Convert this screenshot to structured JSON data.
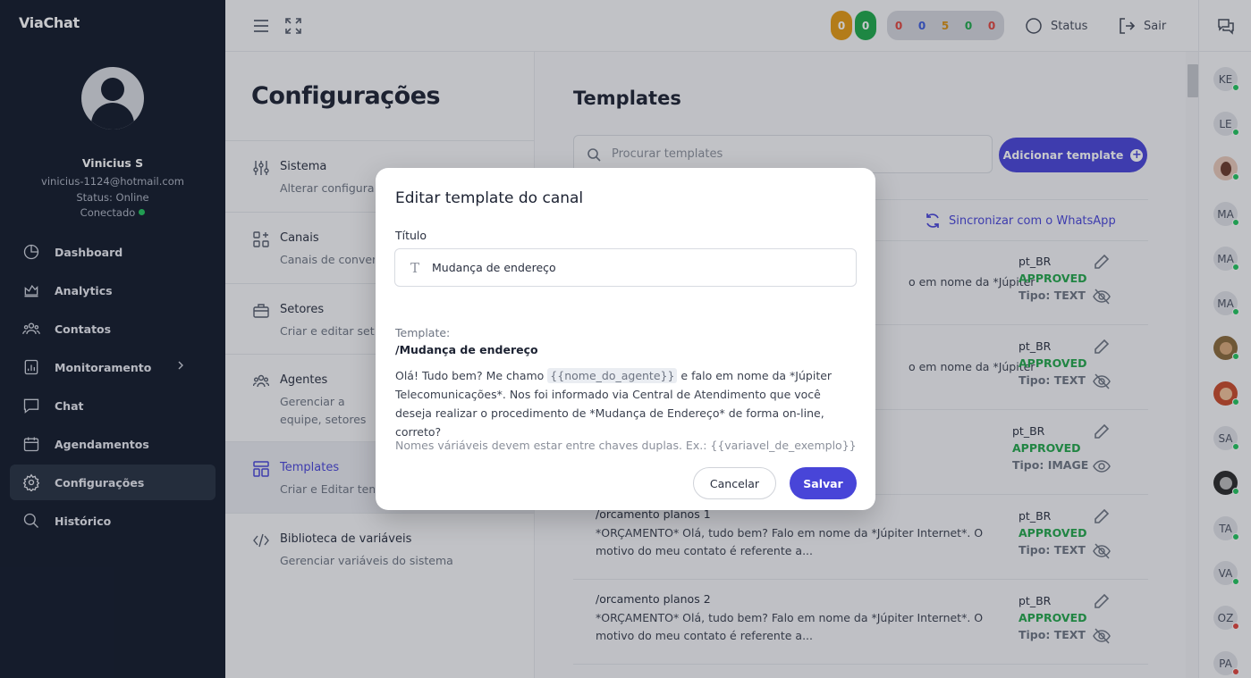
{
  "sidebar": {
    "brand": "ViaChat",
    "user": {
      "name": "Vinicius S",
      "email": "vinicius-1124@hotmail.com",
      "status": "Status: Online",
      "connection": "Conectado"
    },
    "nav": [
      {
        "label": "Dashboard",
        "icon": "dashboard-icon"
      },
      {
        "label": "Analytics",
        "icon": "analytics-icon"
      },
      {
        "label": "Contatos",
        "icon": "contacts-icon"
      },
      {
        "label": "Monitoramento",
        "icon": "monitoring-icon"
      },
      {
        "label": "Chat",
        "icon": "chat-icon"
      },
      {
        "label": "Agendamentos",
        "icon": "calendar-icon"
      },
      {
        "label": "Configurações",
        "icon": "gear-icon",
        "active": true
      },
      {
        "label": "Histórico",
        "icon": "search-icon"
      }
    ]
  },
  "topbar": {
    "counters_a": [
      "0",
      "0"
    ],
    "counters_b": [
      "0",
      "0",
      "5",
      "0",
      "0"
    ],
    "status_label": "Status",
    "logout_label": "Sair"
  },
  "rail": {
    "contacts": [
      "KE",
      "LE",
      "",
      "MA",
      "MA",
      "MA",
      "",
      "",
      "SA",
      "",
      "TA",
      "VA",
      "OZ",
      "PA"
    ]
  },
  "settings": {
    "title": "Configurações",
    "items": [
      {
        "label": "Sistema",
        "desc": "Alterar configurações"
      },
      {
        "label": "Canais",
        "desc": "Canais de conversa"
      },
      {
        "label": "Setores",
        "desc": "Criar e editar setores"
      },
      {
        "label": "Agentes",
        "desc": "Gerenciar a equipe, setores e permissões"
      },
      {
        "label": "Templates",
        "desc": "Criar e Editar templates"
      },
      {
        "label": "Biblioteca de variáveis",
        "desc": "Gerenciar variáveis do sistema"
      }
    ]
  },
  "templates": {
    "title": "Templates",
    "search_placeholder": "Procurar templates",
    "add_label": "Adicionar template",
    "sync_label": "Sincronizar com o WhatsApp",
    "rows": [
      {
        "name": "",
        "body": "o em nome da *Júpiter",
        "lang": "pt_BR",
        "status": "APPROVED",
        "type": "Tipo: TEXT"
      },
      {
        "name": "",
        "body": "o em nome da *Júpiter",
        "lang": "pt_BR",
        "status": "APPROVED",
        "type": "Tipo: TEXT"
      },
      {
        "name": "",
        "body": "",
        "lang": "pt_BR",
        "status": "APPROVED",
        "type": "Tipo: IMAGE"
      },
      {
        "name": "/orcamento planos 1",
        "body": "*ORÇAMENTO* Olá, tudo bem? Falo em nome da *Júpiter Internet*. O motivo do meu contato é referente a...",
        "lang": "pt_BR",
        "status": "APPROVED",
        "type": "Tipo: TEXT"
      },
      {
        "name": "/orcamento planos 2",
        "body": "*ORÇAMENTO* Olá, tudo bem? Falo em nome da *Júpiter Internet*. O motivo do meu contato é referente a...",
        "lang": "pt_BR",
        "status": "APPROVED",
        "type": "Tipo: TEXT"
      }
    ]
  },
  "modal": {
    "title": "Editar template do canal",
    "field_label": "Título",
    "field_value": "Mudança de endereço",
    "template_label": "Template:",
    "template_name": "/Mudança de endereço",
    "body_before": "Olá! Tudo bem? Me chamo ",
    "body_var": "{{nome_do_agente}}",
    "body_after": " e falo em nome da *Júpiter Telecomunicações*. Nos foi informado via Central de Atendimento que você deseja realizar o procedimento de *Mudança de Endereço* de forma on-line, correto?",
    "hint": "Nomes váriáveis devem estar entre chaves duplas. Ex.: {{variavel_de_exemplo}}",
    "cancel_label": "Cancelar",
    "save_label": "Salvar"
  },
  "colors": {
    "accent": "#4845d8",
    "sidebar_bg": "#121a2a",
    "approved": "#22a64a"
  }
}
